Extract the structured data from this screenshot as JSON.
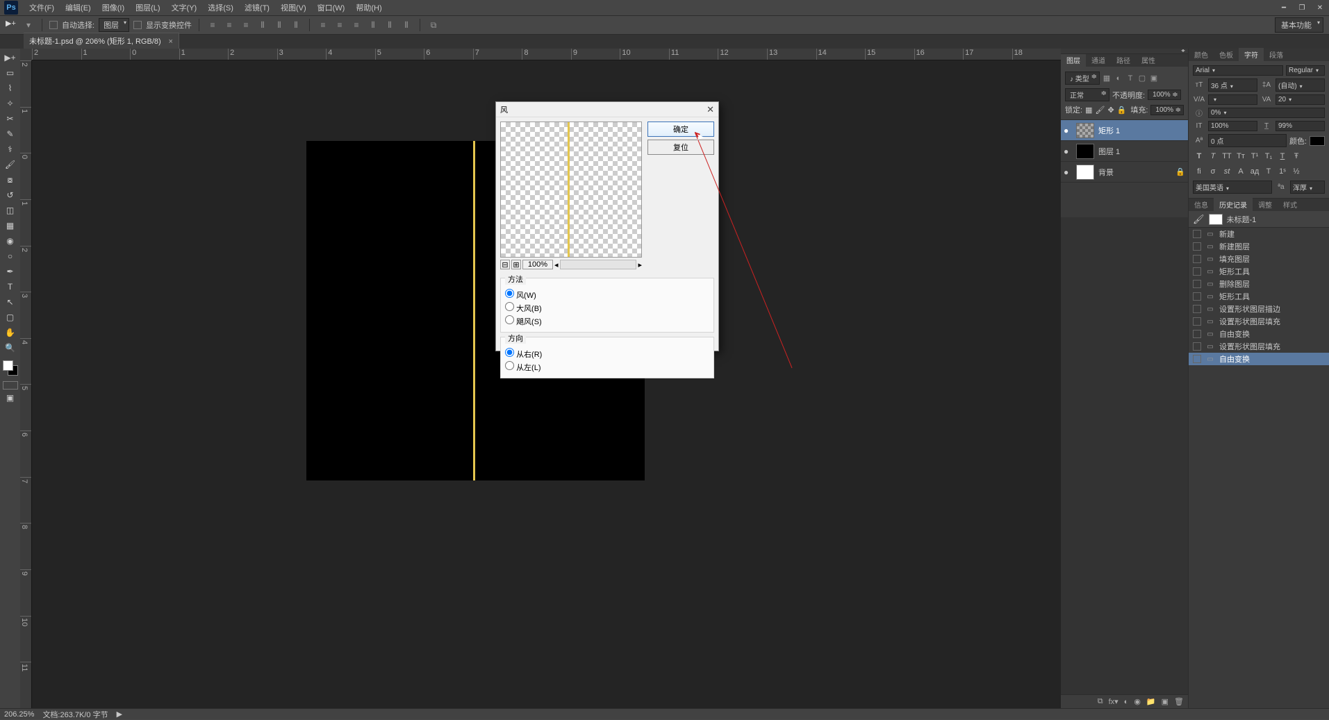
{
  "menu": {
    "items": [
      "文件(F)",
      "编辑(E)",
      "图像(I)",
      "图层(L)",
      "文字(Y)",
      "选择(S)",
      "滤镜(T)",
      "视图(V)",
      "窗口(W)",
      "帮助(H)"
    ]
  },
  "window_controls": {
    "min": "━",
    "max": "❐",
    "close": "✕"
  },
  "optbar": {
    "auto_select": "自动选择:",
    "auto_target": "图层",
    "show_transform": "显示变换控件",
    "workspace": "基本功能"
  },
  "doc_tab": {
    "title": "未标题-1.psd @ 206% (矩形 1, RGB/8)"
  },
  "ruler_h": [
    "2",
    "1",
    "0",
    "1",
    "2",
    "3",
    "4",
    "5",
    "6",
    "7",
    "8",
    "9",
    "10",
    "11",
    "12",
    "13",
    "14",
    "15",
    "16",
    "17",
    "18"
  ],
  "ruler_v": [
    "2",
    "1",
    "0",
    "1",
    "2",
    "3",
    "4",
    "5",
    "6",
    "7",
    "8",
    "9",
    "10",
    "11"
  ],
  "dialog": {
    "title": "风",
    "ok": "确定",
    "reset": "复位",
    "zoom": "100%",
    "method_title": "方法",
    "method_opts": [
      "风(W)",
      "大风(B)",
      "飓风(S)"
    ],
    "direction_title": "方向",
    "direction_opts": [
      "从右(R)",
      "从左(L)"
    ]
  },
  "layers_panel": {
    "tabs": [
      "图层",
      "通道",
      "路径",
      "属性"
    ],
    "kind": "♪ 类型",
    "blend": "正常",
    "opacity_lbl": "不透明度:",
    "opacity": "100%",
    "lock_lbl": "锁定:",
    "fill_lbl": "填充:",
    "fill": "100%",
    "layers": [
      {
        "name": "矩形 1",
        "thumb": "chkbd",
        "sel": true
      },
      {
        "name": "图层 1",
        "thumb": "black"
      },
      {
        "name": "背景",
        "thumb": "white",
        "locked": true
      }
    ]
  },
  "color_tabs": [
    "颜色",
    "色板",
    "字符",
    "段落"
  ],
  "char": {
    "font": "Arial",
    "style": "Regular",
    "size": "36 点",
    "leading": "(自动)",
    "tracking": "",
    "kerning": "20",
    "vscale": "0%",
    "baseline": "",
    "hpct": "100%",
    "wpct": "99%",
    "aa_val": "0 点",
    "color_lbl": "颜色:",
    "lang": "美国英语",
    "aa": "浑厚"
  },
  "info_tabs": [
    "信息",
    "历史记录",
    "调整",
    "样式"
  ],
  "history": {
    "doc": "未标题-1",
    "items": [
      "新建",
      "新建图层",
      "填充图层",
      "矩形工具",
      "删除图层",
      "矩形工具",
      "设置形状图层描边",
      "设置形状图层填充",
      "自由变换",
      "设置形状图层填充",
      "自由变换"
    ]
  },
  "status": {
    "zoom": "206.25%",
    "doc": "文档:263.7K/0 字节"
  }
}
